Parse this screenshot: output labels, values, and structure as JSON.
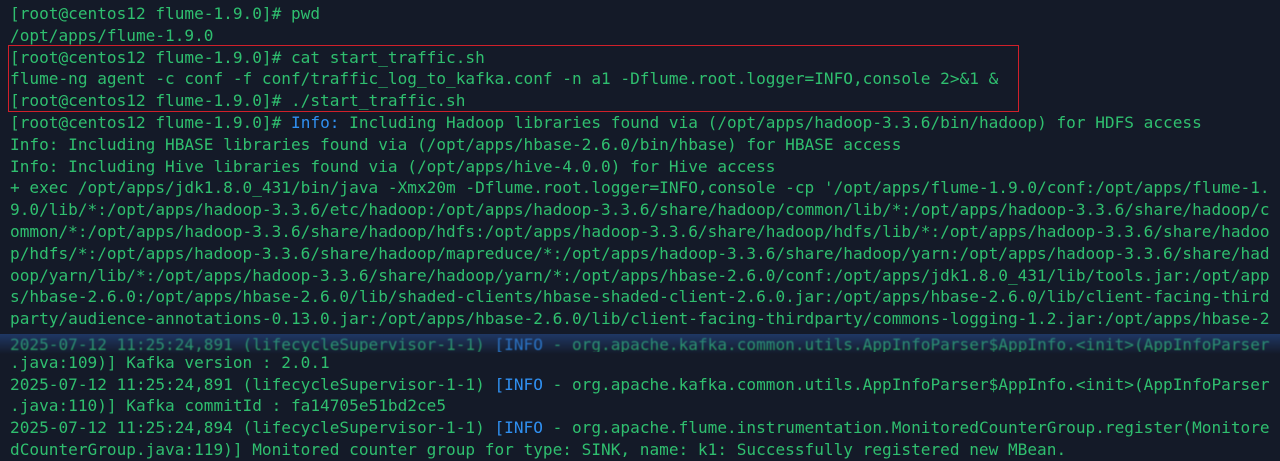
{
  "colors": {
    "background": "#141a28",
    "text": "#2fbf6f",
    "accent_blue": "#2f8ff0",
    "highlight_box": "#d0202a"
  },
  "terminal": {
    "lines": [
      {
        "segments": [
          {
            "text": "[root@centos12 flume-1.9.0]# pwd"
          }
        ]
      },
      {
        "segments": [
          {
            "text": "/opt/apps/flume-1.9.0"
          }
        ]
      },
      {
        "segments": [
          {
            "text": "[root@centos12 flume-1.9.0]# cat start_traffic.sh"
          }
        ]
      },
      {
        "segments": [
          {
            "text": "flume-ng agent -c conf -f conf/traffic_log_to_kafka.conf -n a1 -Dflume.root.logger=INFO,console 2>&1 &"
          }
        ]
      },
      {
        "segments": [
          {
            "text": "[root@centos12 flume-1.9.0]# ./start_traffic.sh"
          }
        ]
      },
      {
        "segments": [
          {
            "text": "[root@centos12 flume-1.9.0]# "
          },
          {
            "text": "Info:",
            "color": "blue"
          },
          {
            "text": " Including Hadoop libraries found via (/opt/apps/hadoop-3.3.6/bin/hadoop) for HDFS access"
          }
        ]
      },
      {
        "segments": [
          {
            "text": "Info: Including HBASE libraries found via (/opt/apps/hbase-2.6.0/bin/hbase) for HBASE access"
          }
        ]
      },
      {
        "segments": [
          {
            "text": "Info: Including Hive libraries found via (/opt/apps/hive-4.0.0) for Hive access"
          }
        ]
      },
      {
        "segments": [
          {
            "text": "+ exec /opt/apps/jdk1.8.0_431/bin/java -Xmx20m -Dflume.root.logger=INFO,console -cp '/opt/apps/flume-1.9.0/conf:/opt/apps/flume-1."
          }
        ]
      },
      {
        "segments": [
          {
            "text": "9.0/lib/*:/opt/apps/hadoop-3.3.6/etc/hadoop:/opt/apps/hadoop-3.3.6/share/hadoop/common/lib/*:/opt/apps/hadoop-3.3.6/share/hadoop/c"
          }
        ]
      },
      {
        "segments": [
          {
            "text": "ommon/*:/opt/apps/hadoop-3.3.6/share/hadoop/hdfs:/opt/apps/hadoop-3.3.6/share/hadoop/hdfs/lib/*:/opt/apps/hadoop-3.3.6/share/hadoo"
          }
        ]
      },
      {
        "segments": [
          {
            "text": "p/hdfs/*:/opt/apps/hadoop-3.3.6/share/hadoop/mapreduce/*:/opt/apps/hadoop-3.3.6/share/hadoop/yarn:/opt/apps/hadoop-3.3.6/share/had"
          }
        ]
      },
      {
        "segments": [
          {
            "text": "oop/yarn/lib/*:/opt/apps/hadoop-3.3.6/share/hadoop/yarn/*:/opt/apps/hbase-2.6.0/conf:/opt/apps/jdk1.8.0_431/lib/tools.jar:/opt/app"
          }
        ]
      },
      {
        "segments": [
          {
            "text": "s/hbase-2.6.0:/opt/apps/hbase-2.6.0/lib/shaded-clients/hbase-shaded-client-2.6.0.jar:/opt/apps/hbase-2.6.0/lib/client-facing-third"
          }
        ]
      },
      {
        "segments": [
          {
            "text": "party/audience-annotations-0.13.0.jar:/opt/apps/hbase-2.6.0/lib/client-facing-thirdparty/commons-logging-1.2.jar:/opt/apps/hbase-2"
          }
        ]
      },
      {
        "glitch": true,
        "segments": [
          {
            "text": "2025-07-12 11:25:24,891 (lifecycleSupervisor-1-1) "
          },
          {
            "text": "[INFO",
            "color": "blue"
          },
          {
            "text": " - org.apache.kafka.common.utils.AppInfoParser$AppInfo.<init>(AppInfoParser"
          }
        ]
      },
      {
        "segments": [
          {
            "text": ".java:109)] Kafka version : 2.0.1"
          }
        ]
      },
      {
        "segments": [
          {
            "text": "2025-07-12 11:25:24,891 (lifecycleSupervisor-1-1) "
          },
          {
            "text": "[INFO",
            "color": "blue"
          },
          {
            "text": " - org.apache.kafka.common.utils.AppInfoParser$AppInfo.<init>(AppInfoParser"
          }
        ]
      },
      {
        "segments": [
          {
            "text": ".java:110)] Kafka commitId : fa14705e51bd2ce5"
          }
        ]
      },
      {
        "segments": [
          {
            "text": "2025-07-12 11:25:24,894 (lifecycleSupervisor-1-1) "
          },
          {
            "text": "[INFO",
            "color": "blue"
          },
          {
            "text": " - org.apache.flume.instrumentation.MonitoredCounterGroup.register(Monitore"
          }
        ]
      },
      {
        "segments": [
          {
            "text": "dCounterGroup.java:119)] Monitored counter group for type: SINK, name: k1: Successfully registered new MBean."
          }
        ]
      }
    ]
  }
}
